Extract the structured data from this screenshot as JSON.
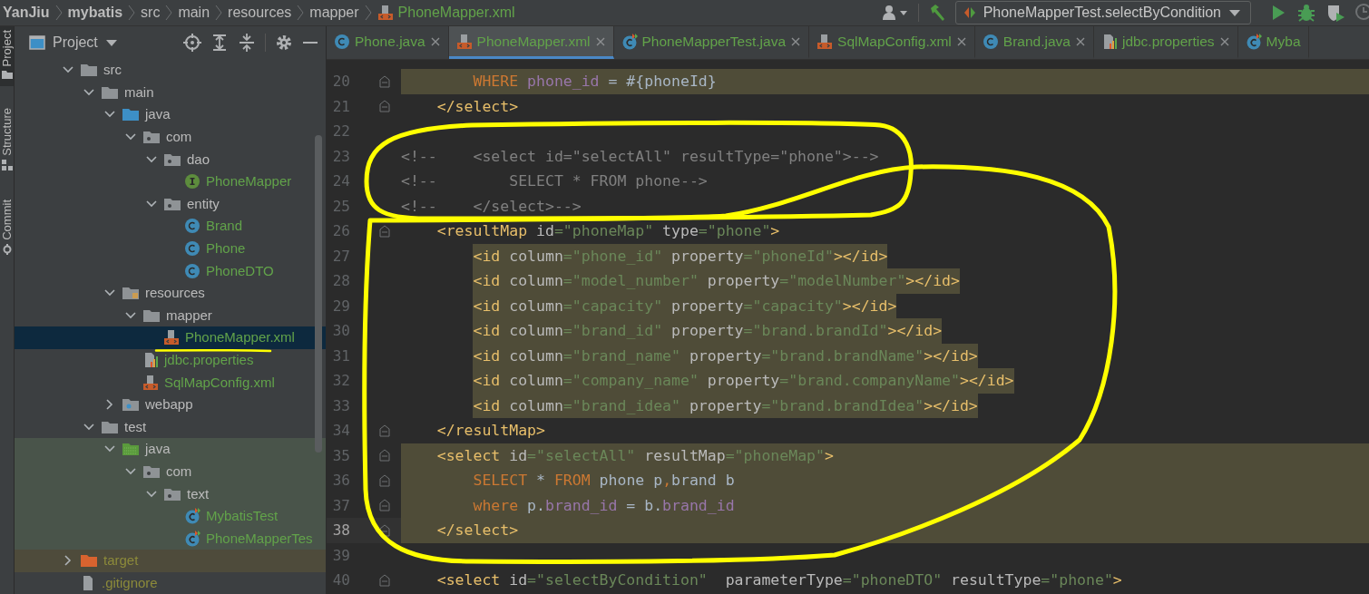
{
  "breadcrumbs": [
    {
      "label": "YanJiu",
      "kind": "project"
    },
    {
      "label": "mybatis",
      "kind": "project"
    },
    {
      "label": "src",
      "kind": "folder"
    },
    {
      "label": "main",
      "kind": "folder"
    },
    {
      "label": "resources",
      "kind": "folder"
    },
    {
      "label": "mapper",
      "kind": "folder"
    },
    {
      "label": "PhoneMapper.xml",
      "kind": "file"
    }
  ],
  "run_config": {
    "label": "PhoneMapperTest.selectByCondition"
  },
  "side_strip": [
    {
      "label": "Project",
      "selected": true
    },
    {
      "label": "Structure",
      "selected": false
    },
    {
      "label": "Commit",
      "selected": false
    }
  ],
  "project_panel": {
    "title": "Project"
  },
  "tree": [
    {
      "label": "src",
      "kind": "folder",
      "expanded": true,
      "color": "#bbbbbb",
      "selected": false,
      "children": [
        {
          "label": "main",
          "kind": "folder",
          "expanded": true,
          "color": "#bbbbbb",
          "selected": false,
          "children": [
            {
              "label": "java",
              "kind": "source",
              "expanded": true,
              "color": "#bbbbbb",
              "selected": false,
              "children": [
                {
                  "label": "com",
                  "kind": "package",
                  "expanded": true,
                  "color": "#bbbbbb",
                  "selected": false,
                  "children": [
                    {
                      "label": "dao",
                      "kind": "package",
                      "expanded": true,
                      "color": "#bbbbbb",
                      "selected": false,
                      "children": [
                        {
                          "label": "PhoneMapper",
                          "kind": "interface",
                          "color": "#62a34a",
                          "selected": false
                        }
                      ]
                    },
                    {
                      "label": "entity",
                      "kind": "package",
                      "expanded": true,
                      "color": "#bbbbbb",
                      "selected": false,
                      "children": [
                        {
                          "label": "Brand",
                          "kind": "class",
                          "color": "#62a34a",
                          "selected": false
                        },
                        {
                          "label": "Phone",
                          "kind": "class",
                          "color": "#62a34a",
                          "selected": false
                        },
                        {
                          "label": "PhoneDTO",
                          "kind": "class",
                          "color": "#62a34a",
                          "selected": false
                        }
                      ]
                    }
                  ]
                }
              ]
            },
            {
              "label": "resources",
              "kind": "resources",
              "expanded": true,
              "color": "#bbbbbb",
              "selected": false,
              "children": [
                {
                  "label": "mapper",
                  "kind": "folder",
                  "expanded": true,
                  "color": "#bbbbbb",
                  "selected": false,
                  "children": [
                    {
                      "label": "PhoneMapper.xml",
                      "kind": "xml",
                      "color": "#62a34a",
                      "selected": true
                    }
                  ]
                },
                {
                  "label": "jdbc.properties",
                  "kind": "properties",
                  "color": "#62a34a",
                  "selected": false
                },
                {
                  "label": "SqlMapConfig.xml",
                  "kind": "xml",
                  "color": "#62a34a",
                  "selected": false
                }
              ]
            },
            {
              "label": "webapp",
              "kind": "web",
              "expanded": false,
              "color": "#bbbbbb",
              "selected": false
            }
          ]
        },
        {
          "label": "test",
          "kind": "folder",
          "expanded": true,
          "color": "#bbbbbb",
          "selected": false,
          "children": [
            {
              "label": "java",
              "kind": "tests",
              "expanded": true,
              "color": "#bbbbbb",
              "selected": false,
              "children": [
                {
                  "label": "com",
                  "kind": "package",
                  "expanded": true,
                  "color": "#bbbbbb",
                  "selected": false,
                  "children": [
                    {
                      "label": "text",
                      "kind": "package",
                      "expanded": true,
                      "color": "#bbbbbb",
                      "selected": false,
                      "children": [
                        {
                          "label": "MybatisTest",
                          "kind": "testclass",
                          "color": "#62a34a",
                          "selected": false
                        },
                        {
                          "label": "PhoneMapperTes",
                          "kind": "testclass",
                          "color": "#62a34a",
                          "selected": false
                        }
                      ]
                    }
                  ]
                }
              ]
            }
          ]
        }
      ]
    },
    {
      "label": "target",
      "kind": "excluded",
      "expanded": false,
      "color": "#8c8a3a",
      "selected": false
    },
    {
      "label": ".gitignore",
      "kind": "file",
      "color": "#8c8a3a",
      "selected": false
    }
  ],
  "tabs": [
    {
      "label": "Phone.java",
      "kind": "class",
      "selected": false,
      "closable": true
    },
    {
      "label": "PhoneMapper.xml",
      "kind": "xml",
      "selected": true,
      "closable": true
    },
    {
      "label": "PhoneMapperTest.java",
      "kind": "testclass",
      "selected": false,
      "closable": true
    },
    {
      "label": "SqlMapConfig.xml",
      "kind": "xml",
      "selected": false,
      "closable": true
    },
    {
      "label": "Brand.java",
      "kind": "class",
      "selected": false,
      "closable": true
    },
    {
      "label": "jdbc.properties",
      "kind": "properties",
      "selected": false,
      "closable": true
    },
    {
      "label": "Myba",
      "kind": "testclass",
      "selected": false,
      "closable": false
    }
  ],
  "editor": {
    "lines": [
      {
        "number": "20",
        "kind": "highlighted",
        "current": false,
        "fold": true,
        "tokens": [
          {
            "kind": "keyword",
            "text": "        WHERE"
          },
          {
            "kind": "column",
            "text": " phone_id"
          },
          {
            "kind": "plain",
            "text": " = #{phoneId}"
          }
        ]
      },
      {
        "number": "21",
        "kind": "plain",
        "current": false,
        "fold": true,
        "tokens": [
          {
            "kind": "tag",
            "text": "    </select>"
          }
        ]
      },
      {
        "number": "22",
        "kind": "plain",
        "current": false,
        "fold": false
      },
      {
        "number": "23",
        "kind": "plain",
        "current": false,
        "fold": false,
        "tokens": [
          {
            "kind": "comment",
            "text": "<!--    <select id=\"selectAll\" resultType=\"phone\">-->"
          }
        ]
      },
      {
        "number": "24",
        "kind": "plain",
        "current": false,
        "fold": false,
        "tokens": [
          {
            "kind": "comment",
            "text": "<!--        SELECT * FROM phone-->"
          }
        ]
      },
      {
        "number": "25",
        "kind": "plain",
        "current": false,
        "fold": false,
        "tokens": [
          {
            "kind": "comment",
            "text": "<!--    </select>-->"
          }
        ]
      },
      {
        "number": "26",
        "kind": "plain",
        "current": false,
        "fold": true,
        "tokens": [
          {
            "kind": "tag",
            "text": "    <resultMap"
          },
          {
            "kind": "attr",
            "text": " id"
          },
          {
            "kind": "value",
            "text": "=\"phoneMap\""
          },
          {
            "kind": "attr",
            "text": " type"
          },
          {
            "kind": "value",
            "text": "=\"phone\""
          },
          {
            "kind": "tag",
            "text": ">"
          }
        ]
      },
      {
        "number": "27",
        "kind": "marked",
        "current": false,
        "fold": false,
        "tokens": [
          {
            "kind": "tag",
            "text": "        <id"
          },
          {
            "kind": "attr",
            "text": " column"
          },
          {
            "kind": "value",
            "text": "=\"phone_id\""
          },
          {
            "kind": "attr",
            "text": " property"
          },
          {
            "kind": "value",
            "text": "=\"phoneId\""
          },
          {
            "kind": "tag",
            "text": "></id>"
          }
        ]
      },
      {
        "number": "28",
        "kind": "marked",
        "current": false,
        "fold": false,
        "tokens": [
          {
            "kind": "tag",
            "text": "        <id"
          },
          {
            "kind": "attr",
            "text": " column"
          },
          {
            "kind": "value",
            "text": "=\"model_number\""
          },
          {
            "kind": "attr",
            "text": " property"
          },
          {
            "kind": "value",
            "text": "=\"modelNumber\""
          },
          {
            "kind": "tag",
            "text": "></id>"
          }
        ]
      },
      {
        "number": "29",
        "kind": "marked",
        "current": false,
        "fold": false,
        "tokens": [
          {
            "kind": "tag",
            "text": "        <id"
          },
          {
            "kind": "attr",
            "text": " column"
          },
          {
            "kind": "value",
            "text": "=\"capacity\""
          },
          {
            "kind": "attr",
            "text": " property"
          },
          {
            "kind": "value",
            "text": "=\"capacity\""
          },
          {
            "kind": "tag",
            "text": "></id>"
          }
        ]
      },
      {
        "number": "30",
        "kind": "marked",
        "current": false,
        "fold": false,
        "tokens": [
          {
            "kind": "tag",
            "text": "        <id"
          },
          {
            "kind": "attr",
            "text": " column"
          },
          {
            "kind": "value",
            "text": "=\"brand_id\""
          },
          {
            "kind": "attr",
            "text": " property"
          },
          {
            "kind": "value",
            "text": "=\"brand.brandId\""
          },
          {
            "kind": "tag",
            "text": "></id>"
          }
        ]
      },
      {
        "number": "31",
        "kind": "marked",
        "current": false,
        "fold": false,
        "tokens": [
          {
            "kind": "tag",
            "text": "        <id"
          },
          {
            "kind": "attr",
            "text": " column"
          },
          {
            "kind": "value",
            "text": "=\"brand_name\""
          },
          {
            "kind": "attr",
            "text": " property"
          },
          {
            "kind": "value",
            "text": "=\"brand.brandName\""
          },
          {
            "kind": "tag",
            "text": "></id>"
          }
        ]
      },
      {
        "number": "32",
        "kind": "marked",
        "current": false,
        "fold": false,
        "tokens": [
          {
            "kind": "tag",
            "text": "        <id"
          },
          {
            "kind": "attr",
            "text": " column"
          },
          {
            "kind": "value",
            "text": "=\"company_name\""
          },
          {
            "kind": "attr",
            "text": " property"
          },
          {
            "kind": "value",
            "text": "=\"brand.companyName\""
          },
          {
            "kind": "tag",
            "text": "></id>"
          }
        ]
      },
      {
        "number": "33",
        "kind": "marked",
        "current": false,
        "fold": false,
        "tokens": [
          {
            "kind": "tag",
            "text": "        <id"
          },
          {
            "kind": "attr",
            "text": " column"
          },
          {
            "kind": "value",
            "text": "=\"brand_idea\""
          },
          {
            "kind": "attr",
            "text": " property"
          },
          {
            "kind": "value",
            "text": "=\"brand.brandIdea\""
          },
          {
            "kind": "tag",
            "text": "></id>"
          }
        ]
      },
      {
        "number": "34",
        "kind": "plain",
        "current": false,
        "fold": true,
        "tokens": [
          {
            "kind": "tag",
            "text": "    </resultMap>"
          }
        ]
      },
      {
        "number": "35",
        "kind": "highlighted",
        "current": false,
        "fold": true,
        "tokens": [
          {
            "kind": "tag",
            "text": "    <select"
          },
          {
            "kind": "attr",
            "text": " id"
          },
          {
            "kind": "value",
            "text": "=\"selectAll\""
          },
          {
            "kind": "attr",
            "text": " resultMap"
          },
          {
            "kind": "value",
            "text": "=\"phoneMap\""
          },
          {
            "kind": "tag",
            "text": ">"
          }
        ]
      },
      {
        "number": "36",
        "kind": "highlighted",
        "current": false,
        "fold": true,
        "tokens": [
          {
            "kind": "keyword",
            "text": "        SELECT"
          },
          {
            "kind": "plain",
            "text": " * "
          },
          {
            "kind": "keyword",
            "text": "FROM"
          },
          {
            "kind": "plain",
            "text": " phone p"
          },
          {
            "kind": "keyword",
            "text": ","
          },
          {
            "kind": "plain",
            "text": "brand b"
          }
        ]
      },
      {
        "number": "37",
        "kind": "highlighted",
        "current": false,
        "fold": true,
        "tokens": [
          {
            "kind": "keyword",
            "text": "        where"
          },
          {
            "kind": "plain",
            "text": " p."
          },
          {
            "kind": "column",
            "text": "brand_id"
          },
          {
            "kind": "plain",
            "text": " = b."
          },
          {
            "kind": "column",
            "text": "brand_id"
          }
        ]
      },
      {
        "number": "38",
        "kind": "highlighted",
        "current": true,
        "fold": true,
        "tokens": [
          {
            "kind": "tag",
            "text": "    </select>"
          }
        ]
      },
      {
        "number": "39",
        "kind": "plain",
        "current": false,
        "fold": false
      },
      {
        "number": "40",
        "kind": "plain",
        "current": false,
        "fold": true,
        "tokens": [
          {
            "kind": "tag",
            "text": "    <select"
          },
          {
            "kind": "attr",
            "text": " id"
          },
          {
            "kind": "value",
            "text": "=\"selectByCondition\""
          },
          {
            "kind": "attr",
            "text": "  parameterType"
          },
          {
            "kind": "value",
            "text": "=\"phoneDTO\""
          },
          {
            "kind": "attr",
            "text": " resultType"
          },
          {
            "kind": "value",
            "text": "=\"phone\""
          },
          {
            "kind": "tag",
            "text": ">"
          }
        ]
      }
    ]
  }
}
